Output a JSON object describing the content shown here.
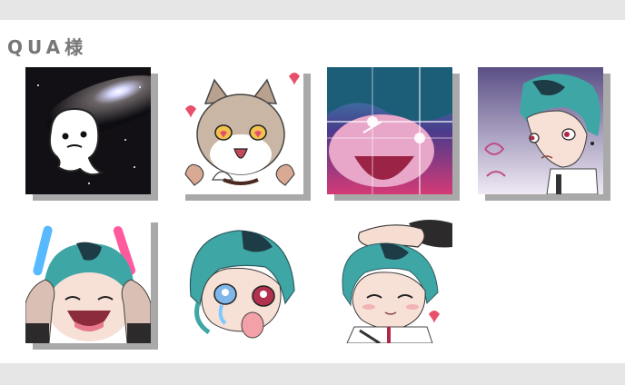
{
  "header": {
    "title": "QUA様"
  },
  "emotes": [
    {
      "name": "ghost-in-space",
      "icon": "ghost-space-icon"
    },
    {
      "name": "cat-with-hearts",
      "icon": "cat-icon"
    },
    {
      "name": "glitch-shocked",
      "icon": "glitch-face-icon"
    },
    {
      "name": "side-glance",
      "icon": "side-glance-icon"
    },
    {
      "name": "penlight-cheer",
      "icon": "penlight-icon"
    },
    {
      "name": "crying-face",
      "icon": "crying-icon"
    },
    {
      "name": "head-pat",
      "icon": "headpat-icon"
    }
  ],
  "colors": {
    "hair": "#3fa6a6",
    "hair_dark": "#1e3c46",
    "skin": "#f7e0d6",
    "shadow": "#a9a9a9",
    "title": "#777777",
    "band": "#e6e6e6"
  }
}
